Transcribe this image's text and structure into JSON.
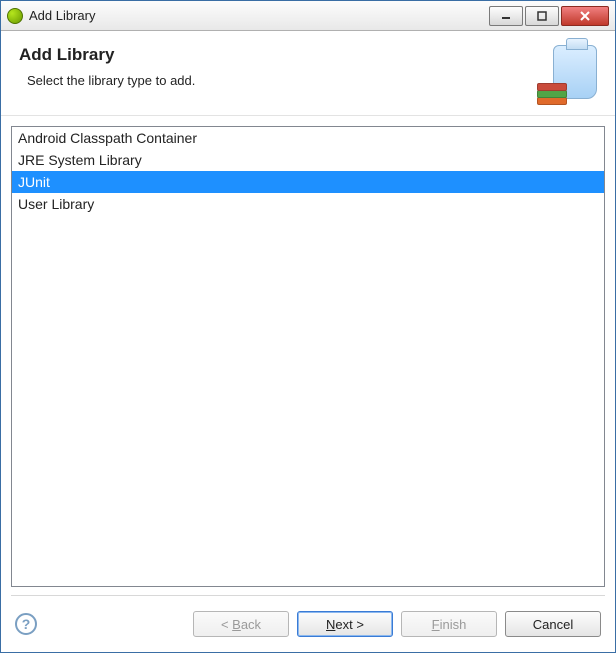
{
  "window": {
    "title": "Add Library"
  },
  "header": {
    "title": "Add Library",
    "subtitle": "Select the library type to add."
  },
  "list": {
    "items": [
      {
        "label": "Android Classpath Container",
        "selected": false
      },
      {
        "label": "JRE System Library",
        "selected": false
      },
      {
        "label": "JUnit",
        "selected": true
      },
      {
        "label": "User Library",
        "selected": false
      }
    ]
  },
  "buttons": {
    "back_prefix": "< ",
    "back_mn": "B",
    "back_suffix": "ack",
    "next_mn": "N",
    "next_suffix": "ext >",
    "finish_mn": "F",
    "finish_suffix": "inish",
    "cancel": "Cancel"
  }
}
